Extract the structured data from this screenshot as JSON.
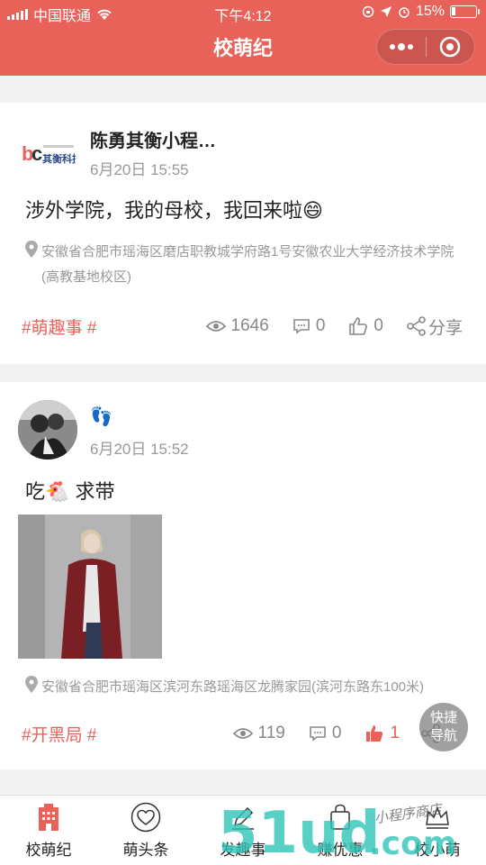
{
  "status_bar": {
    "carrier": "中国联通",
    "time": "下午4:12",
    "battery": "15%"
  },
  "nav": {
    "title": "校萌纪",
    "more_icon": "more-dots-icon",
    "close_icon": "target-circle-icon"
  },
  "posts": [
    {
      "author": "陈勇其衡小程…",
      "time": "6月20日 15:55",
      "content": "涉外学院，我的母校，我回来啦😄",
      "location": "安徽省合肥市瑶海区磨店职教城学府路1号安徽农业大学经济技术学院(高教基地校区)",
      "tag": "#萌趣事 #",
      "views": "1646",
      "comments": "0",
      "likes": "0",
      "share": "分享",
      "logo_text": "其衡科技"
    },
    {
      "author": "👣",
      "time": "6月20日 15:52",
      "content": "吃🐔 求带",
      "location": "安徽省合肥市瑶海区滨河东路瑶海区龙腾家园(滨河东路东100米)",
      "tag": "#开黑局 #",
      "views": "119",
      "comments": "0",
      "likes": "1"
    }
  ],
  "fab": {
    "line1": "快捷",
    "line2": "导航"
  },
  "tabs": [
    {
      "label": "校萌纪",
      "icon": "building-icon",
      "active": true
    },
    {
      "label": "萌头条",
      "icon": "heart-icon"
    },
    {
      "label": "发趣事",
      "icon": "pencil-icon"
    },
    {
      "label": "赚优惠",
      "icon": "shopping-bag-icon"
    },
    {
      "label": "校小萌",
      "icon": "crown-icon"
    }
  ],
  "watermark": {
    "text": "51ud.com",
    "sub": "小程序商店"
  },
  "colors": {
    "accent": "#e8625a",
    "muted": "#999999",
    "watermark": "#2ec4b6"
  }
}
